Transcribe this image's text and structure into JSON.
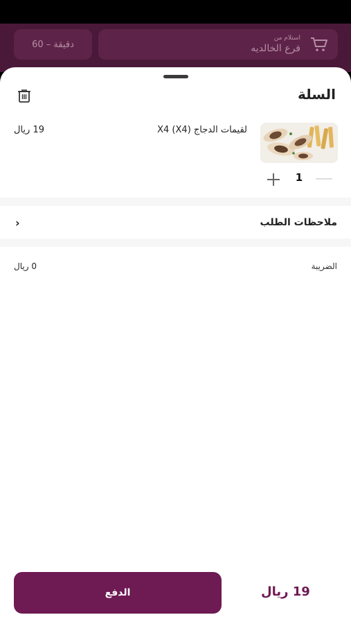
{
  "background_header": {
    "branch_label": "استلام من",
    "branch_name": "فرع الخالديه",
    "prep_time": "60 – دقيقة"
  },
  "cart": {
    "title": "السلة",
    "item": {
      "name": "لقيمات الدجاج (X4) X4",
      "price": "19 ريال",
      "quantity": "1"
    },
    "notes_label": "ملاحظات الطلب",
    "tax_label": "الضريبة",
    "tax_value": "0 ريال"
  },
  "footer": {
    "pay_label": "الدفع",
    "total": "19 ريال"
  },
  "colors": {
    "brand": "#6e1a53",
    "overlay_header": "#4a1838"
  }
}
